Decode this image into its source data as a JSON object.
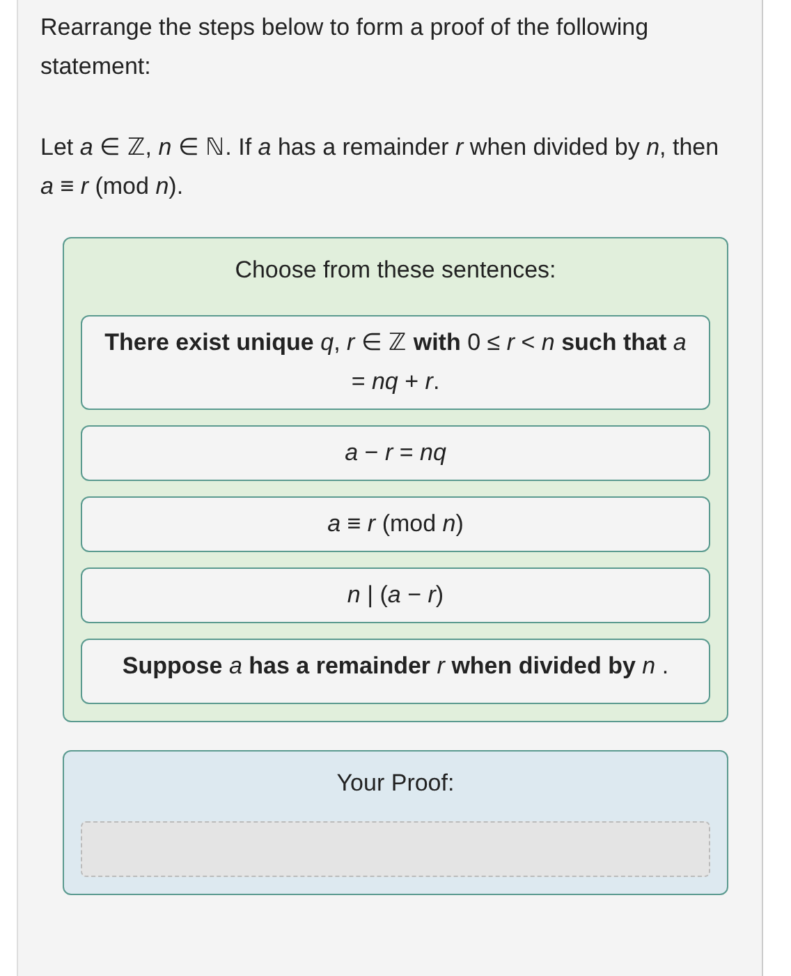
{
  "instructions": "Rearrange the steps below to form a proof of the following statement:",
  "statement": "Let *a* ∈ ℤ, *n* ∈ ℕ. If *a* has a remainder *r* when divided by *n*, then *a* ≡ *r*  (mod  *n*).",
  "choices": {
    "title": "Choose from these sentences:",
    "items": [
      {
        "text": "**There exist unique** *q*, *r* ∈ ℤ **with** 0 ≤ *r* < *n* **such that** *a* = *nq* + *r*."
      },
      {
        "text": "*a* − *r* = *nq*"
      },
      {
        "text": "*a* ≡ *r*  (mod  *n*)"
      },
      {
        "text": "*n* | (*a* − *r*)"
      },
      {
        "text": "**Suppose** *a* **has a remainder** *r* **when divided by** *n* ."
      }
    ]
  },
  "proof": {
    "title": "Your Proof:"
  }
}
